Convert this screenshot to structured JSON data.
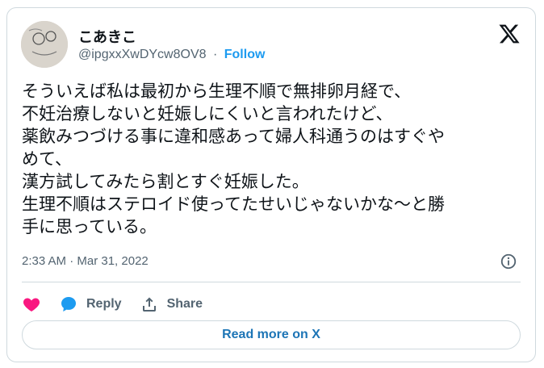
{
  "author": {
    "name": "こあきこ",
    "handle": "@ipgxxXwDYcw8OV8",
    "separator": "·",
    "follow_label": "Follow"
  },
  "tweet": {
    "lines": [
      "そういえば私は最初から生理不順で無排卵月経で、",
      "不妊治療しないと妊娠しにくいと言われたけど、",
      "薬飲みつづける事に違和感あって婦人科通うのはすぐや",
      "めて、",
      "漢方試してみたら割とすぐ妊娠した。",
      "生理不順はステロイド使ってたせいじゃないかな〜と勝",
      "手に思っている。"
    ],
    "timestamp": "2:33 AM · Mar 31, 2022"
  },
  "actions": {
    "like_icon": "heart-icon",
    "reply_label": "Reply",
    "share_label": "Share"
  },
  "read_more_label": "Read more on X",
  "colors": {
    "like": "#f91880",
    "reply": "#1d9bf0",
    "link": "#1d9bf0",
    "read_more": "#1d75b6",
    "text": "#0f1419",
    "muted": "#536471",
    "border": "#cfd9de"
  }
}
